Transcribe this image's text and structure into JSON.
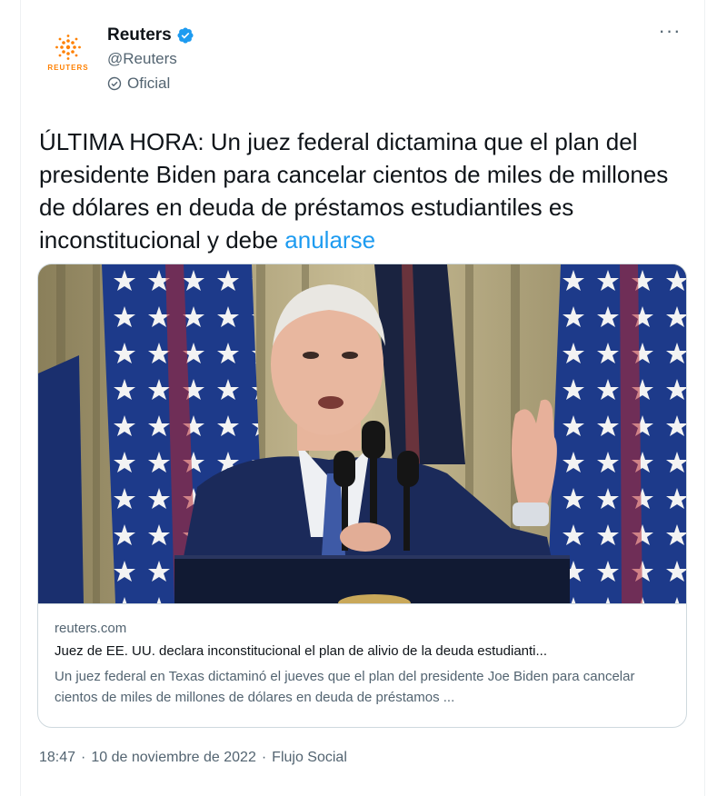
{
  "account": {
    "display_name": "Reuters",
    "handle": "@Reuters",
    "label": "Oficial",
    "logo_word": "REUTERS"
  },
  "menu": {
    "more_label": "···"
  },
  "tweet": {
    "text": "ÚLTIMA HORA: Un juez federal dictamina que el plan del presidente Biden para cancelar cientos de miles de millones de dólares en deuda de préstamos estudiantiles es inconstitucional y debe ",
    "link_text": "anularse"
  },
  "link_card": {
    "domain": "reuters.com",
    "title": "Juez de EE. UU. declara inconstitucional el plan de alivio de la deuda estudianti...",
    "description": "Un juez federal en Texas dictaminó el jueves que el plan del presidente Joe Biden para cancelar cientos de miles de millones de dólares en deuda de préstamos ..."
  },
  "meta": {
    "time": "18:47",
    "separator1": "·",
    "date": "10 de noviembre de 2022",
    "separator2": "·",
    "source": "Flujo Social"
  },
  "colors": {
    "accent": "#1d9bf0",
    "verified": "#1d9bf0",
    "brand_orange": "#ff8000",
    "text_secondary": "#536471"
  },
  "icons": {
    "verified": "verified-badge-icon",
    "label": "official-label-icon",
    "more": "more-options-icon"
  }
}
